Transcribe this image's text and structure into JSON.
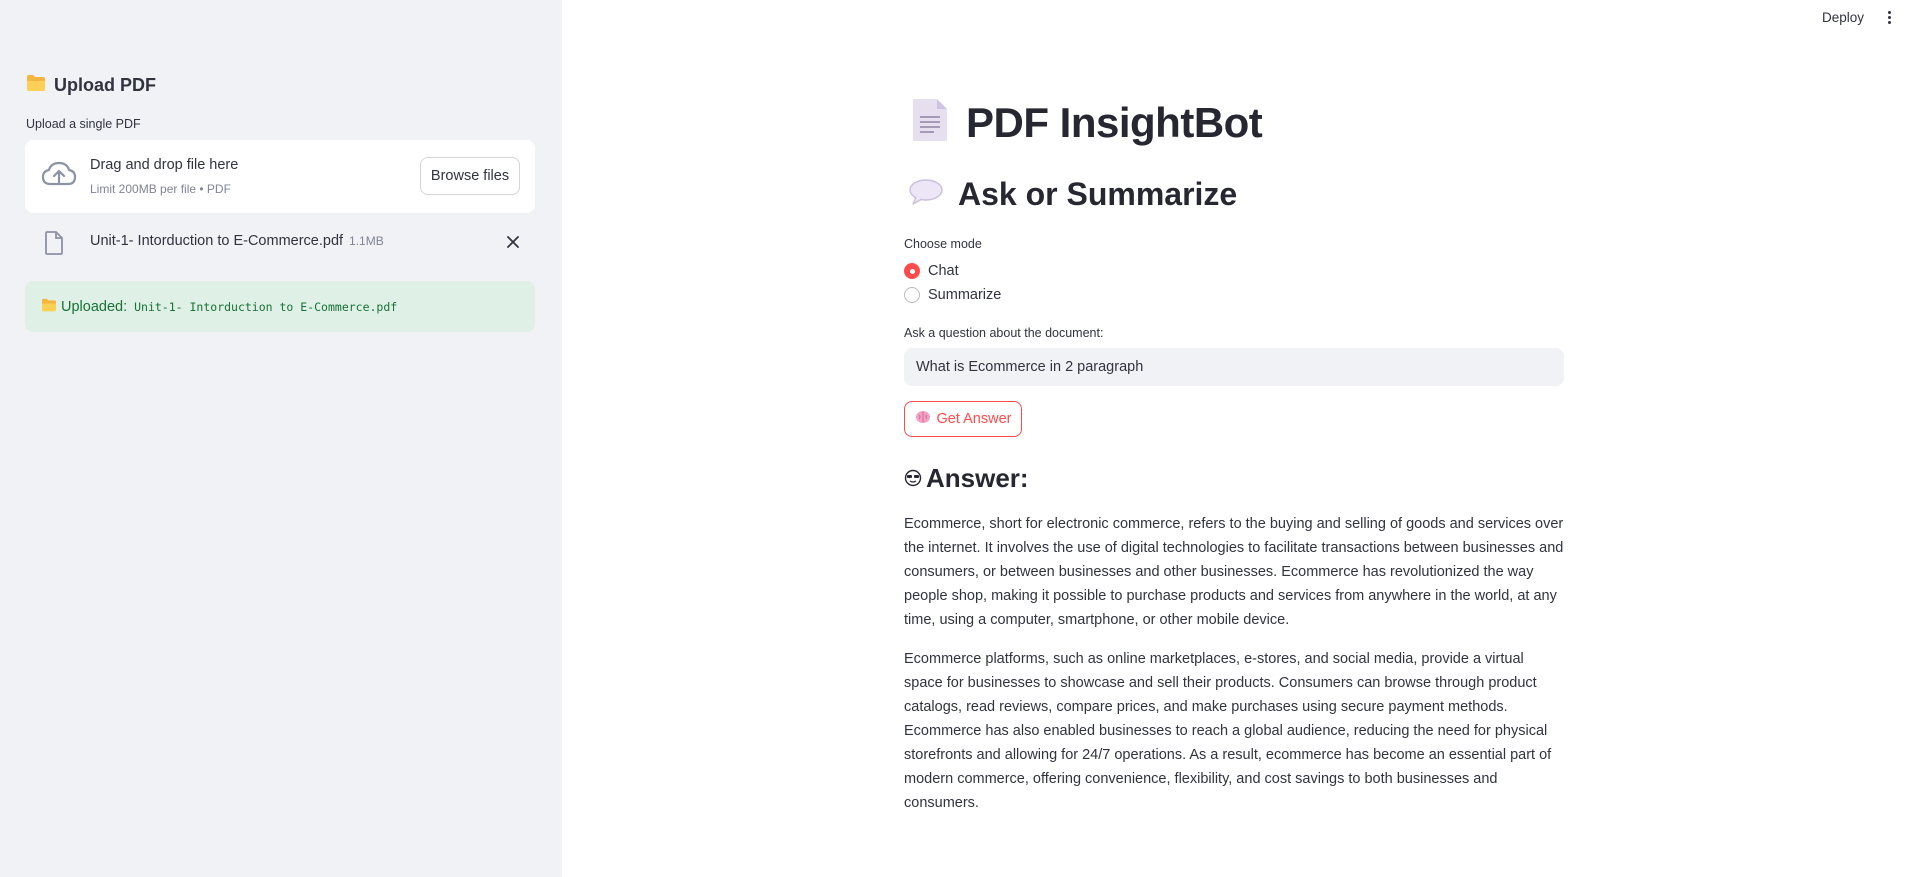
{
  "sidebar": {
    "header": "Upload PDF",
    "upload_label": "Upload a single PDF",
    "dropzone": {
      "title": "Drag and drop file here",
      "subtitle": "Limit 200MB per file • PDF",
      "browse_label": "Browse files"
    },
    "file": {
      "name": "Unit-1- Intorduction to E-Commerce.pdf",
      "size": "1.1MB"
    },
    "success": {
      "prefix": "Uploaded:",
      "filename": "Unit-1- Intorduction to E-Commerce.pdf"
    }
  },
  "topbar": {
    "deploy_label": "Deploy"
  },
  "main": {
    "title": "PDF InsightBot",
    "subtitle": "Ask or Summarize",
    "mode_label": "Choose mode",
    "modes": [
      {
        "label": "Chat",
        "selected": true
      },
      {
        "label": "Summarize",
        "selected": false
      }
    ],
    "question_label": "Ask a question about the document:",
    "question_value": "What is Ecommerce in 2 paragraph",
    "button_label": "Get Answer",
    "answer_heading": "Answer:",
    "answer_paragraphs": [
      "Ecommerce, short for electronic commerce, refers to the buying and selling of goods and services over the internet. It involves the use of digital technologies to facilitate transactions between businesses and consumers, or between businesses and other businesses. Ecommerce has revolutionized the way people shop, making it possible to purchase products and services from anywhere in the world, at any time, using a computer, smartphone, or other mobile device.",
      "Ecommerce platforms, such as online marketplaces, e-stores, and social media, provide a virtual space for businesses to showcase and sell their products. Consumers can browse through product catalogs, read reviews, compare prices, and make purchases using secure payment methods. Ecommerce has also enabled businesses to reach a global audience, reducing the need for physical storefronts and allowing for 24/7 operations. As a result, ecommerce has become an essential part of modern commerce, offering convenience, flexibility, and cost savings to both businesses and consumers."
    ]
  },
  "colors": {
    "accent": "#ff4b4b",
    "sidebar_bg": "#f0f2f6",
    "success_bg": "#dff0e7",
    "success_text": "#177233"
  },
  "icons": [
    "folder-icon",
    "cloud-upload-icon",
    "file-icon",
    "close-icon",
    "document-icon",
    "speech-bubble-icon",
    "brain-icon",
    "sunglasses-icon",
    "more-vert-icon"
  ]
}
